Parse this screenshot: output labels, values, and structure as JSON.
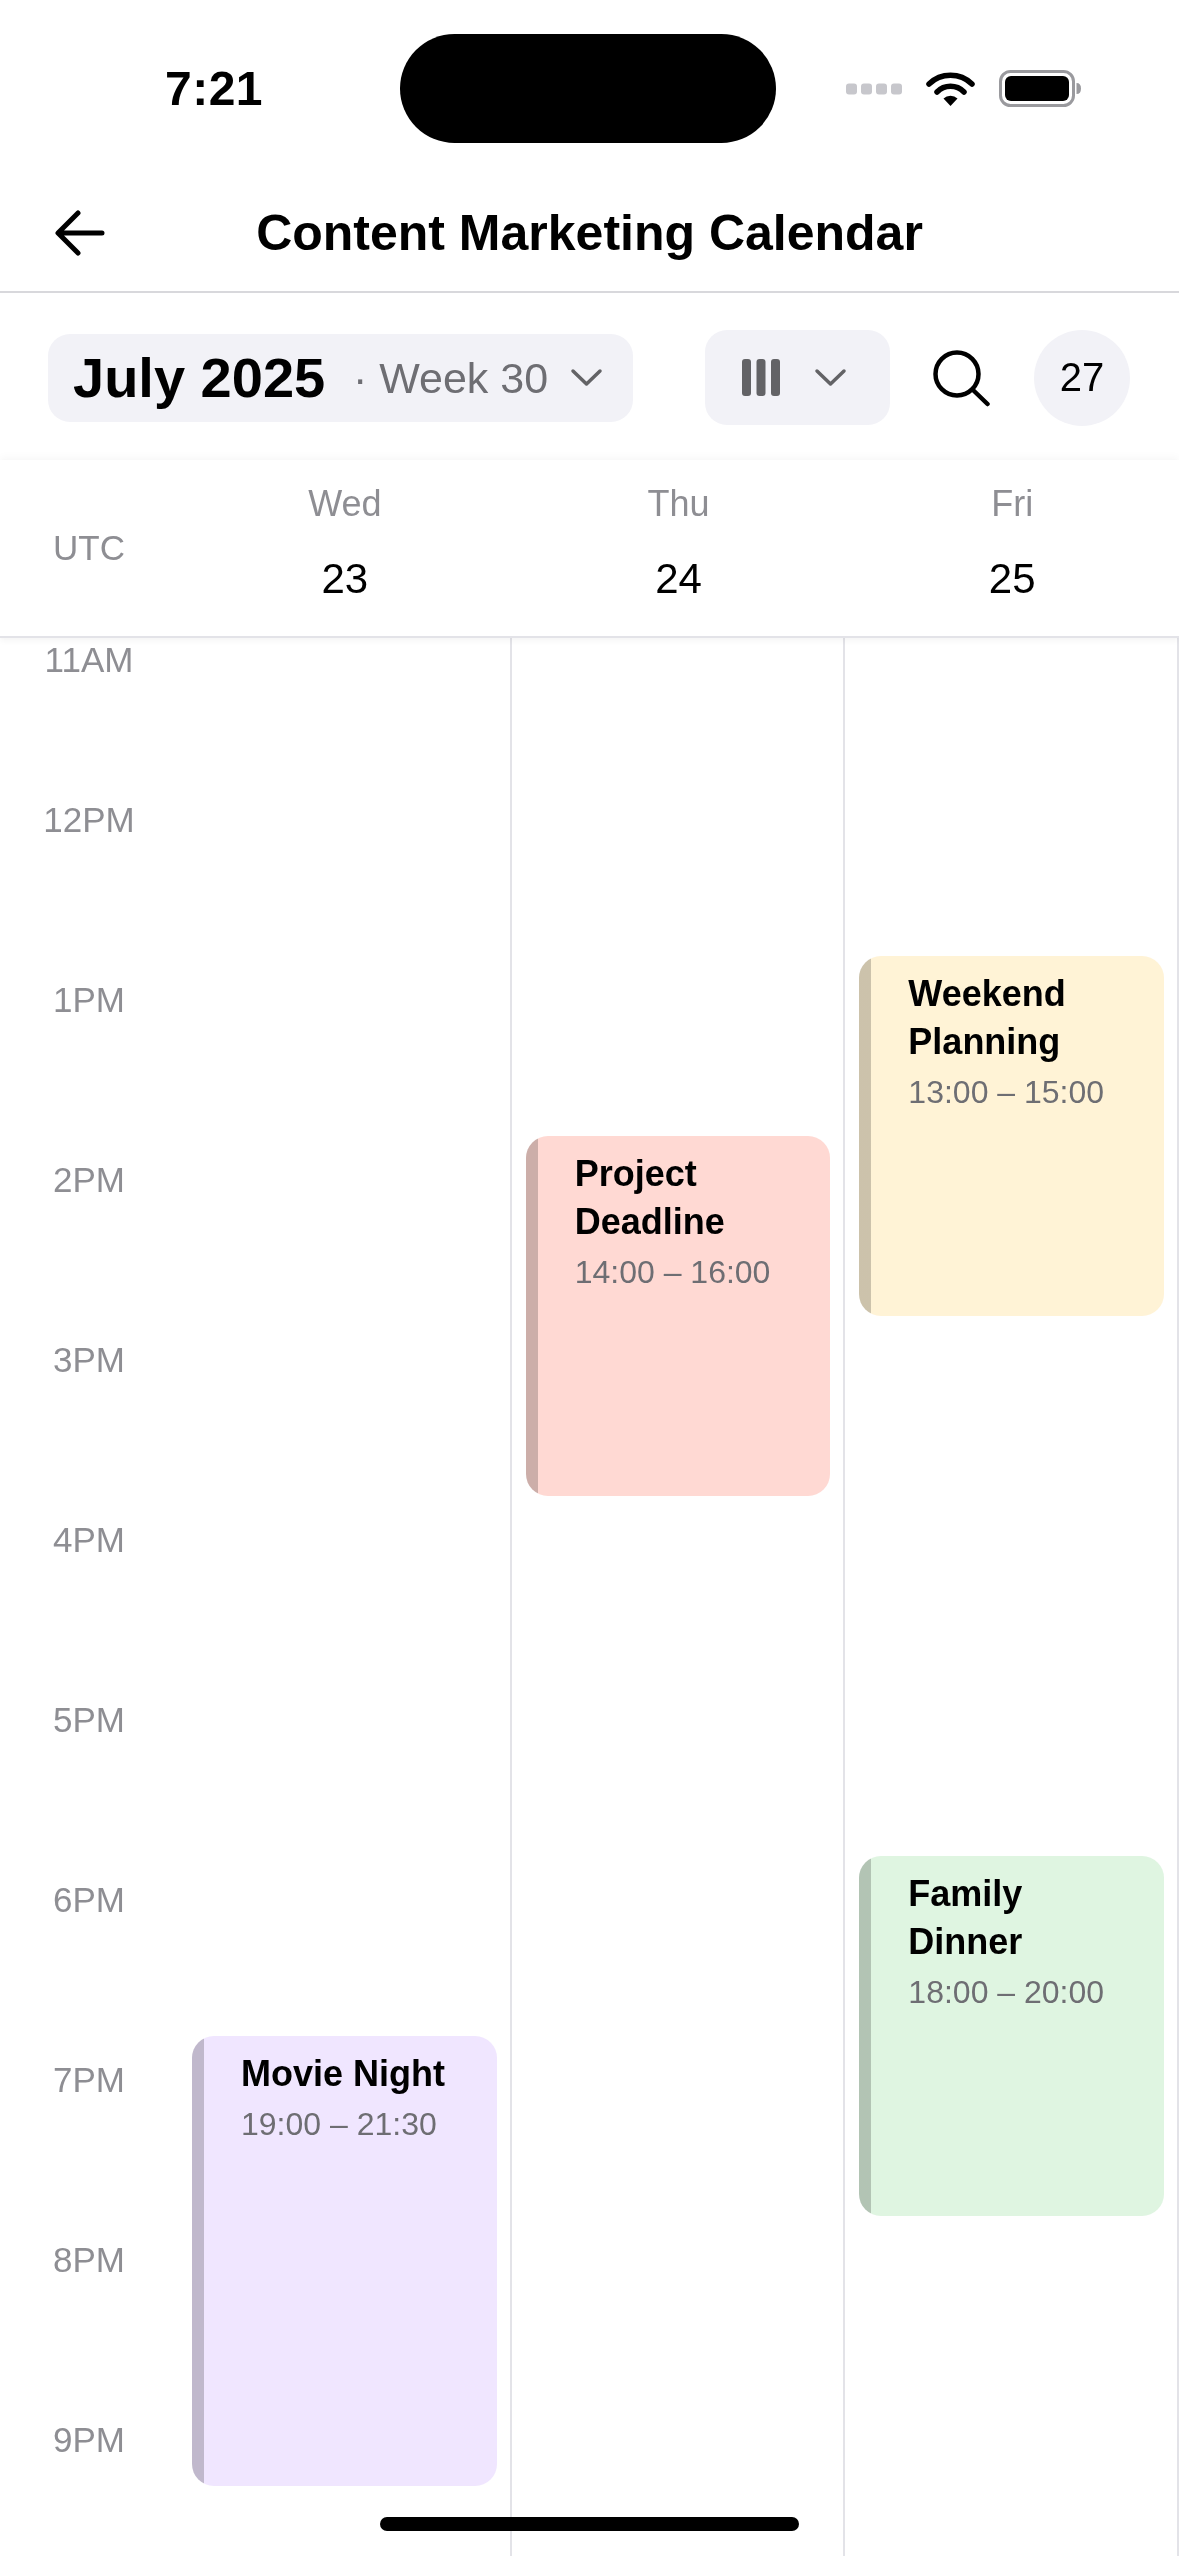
{
  "status_bar": {
    "time": "7:21"
  },
  "nav": {
    "title": "Content Marketing Calendar"
  },
  "toolbar": {
    "month": "July 2025",
    "week": "· Week 30",
    "today": "27"
  },
  "calendar": {
    "timezone": "UTC",
    "days": [
      {
        "name": "Wed",
        "date": "23",
        "events": [
          {
            "title": "Movie Night",
            "time": "19:00 – 21:30",
            "color": "#f0e6ff"
          }
        ]
      },
      {
        "name": "Thu",
        "date": "24",
        "events": [
          {
            "title": "Project Deadline",
            "time": "14:00 – 16:00",
            "color": "#ffd9d3"
          }
        ]
      },
      {
        "name": "Fri",
        "date": "25",
        "events": [
          {
            "title": "Weekend Planning",
            "time": "13:00 – 15:00",
            "color": "#fff3d6"
          },
          {
            "title": "Family Dinner",
            "time": "18:00 – 20:00",
            "color": "#dff5e1"
          }
        ]
      }
    ],
    "hours": [
      "11AM",
      "12PM",
      "1PM",
      "2PM",
      "3PM",
      "4PM",
      "5PM",
      "6PM",
      "7PM",
      "8PM",
      "9PM"
    ]
  }
}
